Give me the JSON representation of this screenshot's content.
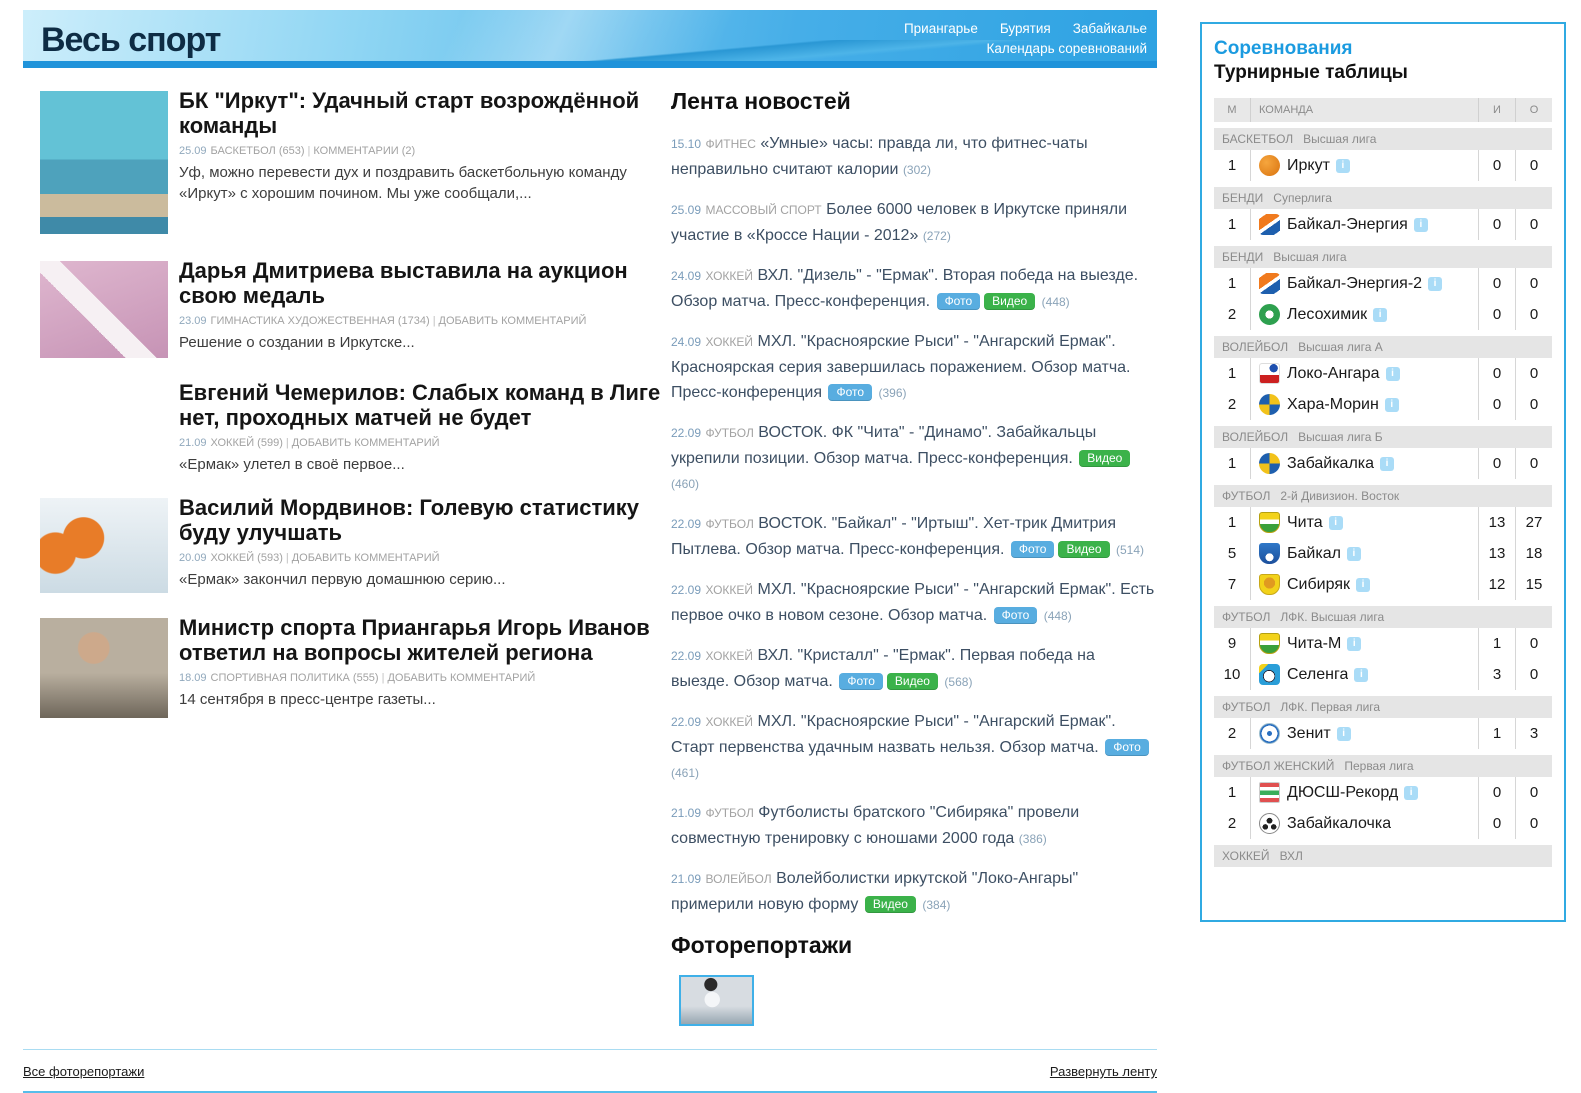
{
  "header": {
    "site_title": "Весь спорт",
    "nav": [
      {
        "label": "Приангарье"
      },
      {
        "label": "Бурятия"
      },
      {
        "label": "Забайкалье"
      }
    ],
    "calendar_label": "Календарь соревнований"
  },
  "featured": {
    "meta_separator": "|",
    "articles": [
      {
        "title": "БК \"Иркут\": Удачный старт возрождённой команды",
        "date": "25.09",
        "category": "БАСКЕТБОЛ (653)",
        "comments": "КОММЕНТАРИИ (2)",
        "excerpt": "Уф, можно перевести дух и поздравить баскетбольную команду «Иркут» с хорошим почином. Мы уже сообщали,...",
        "image": "basketball-team"
      },
      {
        "title": "Дарья Дмитриева выставила на аукцион свою медаль",
        "date": "23.09",
        "category": "ГИМНАСТИКА ХУДОЖЕСТВЕННАЯ (1734)",
        "comments": "ДОБАВИТЬ КОММЕНТАРИЙ",
        "excerpt": "Решение о создании в Иркутске...",
        "image": "medal-hand"
      },
      {
        "title": "Евгений Чемерилов: Слабых команд в Лиге нет, проходных матчей не будет",
        "date": "21.09",
        "category": "ХОККЕЙ (599)",
        "comments": "ДОБАВИТЬ КОММЕНТАРИЙ",
        "excerpt": "«Ермак» улетел в своё первое...",
        "image": ""
      },
      {
        "title": "Василий Мордвинов: Голевую статистику буду улучшать",
        "date": "20.09",
        "category": "ХОККЕЙ (593)",
        "comments": "ДОБАВИТЬ КОММЕНТАРИЙ",
        "excerpt": "«Ермак» закончил первую домашнюю серию...",
        "image": "hockey-players"
      },
      {
        "title": "Министр спорта Приангарья Игорь Иванов ответил на вопросы жителей региона",
        "date": "18.09",
        "category": "СПОРТИВНАЯ ПОЛИТИКА (555)",
        "comments": "ДОБАВИТЬ КОММЕНТАРИЙ",
        "excerpt": "14 сентября в пресс-центре газеты...",
        "image": "minister-portrait"
      }
    ]
  },
  "news": {
    "title": "Лента новостей",
    "expand_link": "Развернуть ленту",
    "items": [
      {
        "date": "15.10",
        "category": "ФИТНЕС",
        "title": "«Умные» часы: правда ли, что фитнес-чаты неправильно считают калории",
        "views": "(302)",
        "badges": []
      },
      {
        "date": "25.09",
        "category": "МАССОВЫЙ СПОРТ",
        "title": "Более 6000 человек в Иркутске приняли участие в «Кроссе Нации - 2012»",
        "views": "(272)",
        "badges": []
      },
      {
        "date": "24.09",
        "category": "ХОККЕЙ",
        "title": "ВХЛ. \"Дизель\" - \"Ермак\". Вторая победа на выезде. Обзор матча. Пресс-конференция.",
        "views": "(448)",
        "badges": [
          {
            "label": "Фото",
            "type": "photo"
          },
          {
            "label": "Видео",
            "type": "video"
          }
        ]
      },
      {
        "date": "24.09",
        "category": "ХОККЕЙ",
        "title": "МХЛ. \"Красноярские Рыси\" - \"Ангарский Ермак\". Красноярская серия завершилась поражением. Обзор матча. Пресс-конференция",
        "views": "(396)",
        "badges": [
          {
            "label": "Фото",
            "type": "photo"
          }
        ]
      },
      {
        "date": "22.09",
        "category": "ФУТБОЛ",
        "title": "ВОСТОК. ФК \"Чита\" - \"Динамо\". Забайкальцы укрепили позиции. Обзор матча. Пресс-конференция.",
        "views": "(460)",
        "badges": [
          {
            "label": "Видео",
            "type": "video"
          }
        ]
      },
      {
        "date": "22.09",
        "category": "ФУТБОЛ",
        "title": "ВОСТОК. \"Байкал\" - \"Иртыш\". Хет-трик Дмитрия Пытлева. Обзор матча. Пресс-конференция.",
        "views": "(514)",
        "badges": [
          {
            "label": "Фото",
            "type": "photo"
          },
          {
            "label": "Видео",
            "type": "video"
          }
        ]
      },
      {
        "date": "22.09",
        "category": "ХОККЕЙ",
        "title": "МХЛ. \"Красноярские Рыси\" - \"Ангарский Ермак\". Есть первое очко в новом сезоне. Обзор матча.",
        "views": "(448)",
        "badges": [
          {
            "label": "Фото",
            "type": "photo"
          }
        ]
      },
      {
        "date": "22.09",
        "category": "ХОККЕЙ",
        "title": "ВХЛ. \"Кристалл\" - \"Ермак\". Первая победа на выезде. Обзор матча.",
        "views": "(568)",
        "badges": [
          {
            "label": "Фото",
            "type": "photo"
          },
          {
            "label": "Видео",
            "type": "video"
          }
        ]
      },
      {
        "date": "22.09",
        "category": "ХОККЕЙ",
        "title": "МХЛ. \"Красноярские Рыси\" - \"Ангарский Ермак\". Старт первенства удачным назвать нельзя. Обзор матча.",
        "views": "(461)",
        "badges": [
          {
            "label": "Фото",
            "type": "photo"
          }
        ]
      },
      {
        "date": "21.09",
        "category": "ФУТБОЛ",
        "title": "Футболисты братского \"Сибиряка\" провели совместную тренировку с юношами 2000 года",
        "views": "(386)",
        "badges": []
      },
      {
        "date": "21.09",
        "category": "ВОЛЕЙБОЛ",
        "title": "Волейболистки иркутской \"Локо-Ангары\" примерили новую форму",
        "views": "(384)",
        "badges": [
          {
            "label": "Видео",
            "type": "video"
          }
        ]
      }
    ]
  },
  "photo_reports": {
    "title": "Фоторепортажи",
    "all_link": "Все фоторепортажи",
    "thumbnails": [
      {
        "image": "football-throw-in"
      }
    ]
  },
  "standings": {
    "title": "Соревнования",
    "subtitle": "Турнирные таблицы",
    "info_glyph": "i",
    "columns": {
      "rank": "М",
      "team": "КОМАНДА",
      "games": "И",
      "points": "О"
    },
    "groups": [
      {
        "sport": "БАСКЕТБОЛ",
        "league": "Высшая лига",
        "rows": [
          {
            "rank": "1",
            "team": "Иркут",
            "games": "0",
            "points": "0",
            "info": true,
            "logo": "irkut"
          }
        ]
      },
      {
        "sport": "БЕНДИ",
        "league": "Суперлига",
        "rows": [
          {
            "rank": "1",
            "team": "Байкал-Энергия",
            "games": "0",
            "points": "0",
            "info": true,
            "logo": "benergia"
          }
        ]
      },
      {
        "sport": "БЕНДИ",
        "league": "Высшая лига",
        "rows": [
          {
            "rank": "1",
            "team": "Байкал-Энергия-2",
            "games": "0",
            "points": "0",
            "info": true,
            "logo": "benergia"
          },
          {
            "rank": "2",
            "team": "Лесохимик",
            "games": "0",
            "points": "0",
            "info": true,
            "logo": "lesohimik"
          }
        ]
      },
      {
        "sport": "ВОЛЕЙБОЛ",
        "league": "Высшая лига А",
        "rows": [
          {
            "rank": "1",
            "team": "Локо-Ангара",
            "games": "0",
            "points": "0",
            "info": true,
            "logo": "loko"
          },
          {
            "rank": "2",
            "team": "Хара-Морин",
            "games": "0",
            "points": "0",
            "info": true,
            "logo": "volley"
          }
        ]
      },
      {
        "sport": "ВОЛЕЙБОЛ",
        "league": "Высшая лига Б",
        "rows": [
          {
            "rank": "1",
            "team": "Забайкалка",
            "games": "0",
            "points": "0",
            "info": true,
            "logo": "volley"
          }
        ]
      },
      {
        "sport": "ФУТБОЛ",
        "league": "2-й Дивизион. Восток",
        "rows": [
          {
            "rank": "1",
            "team": "Чита",
            "games": "13",
            "points": "27",
            "info": true,
            "logo": "chita"
          },
          {
            "rank": "5",
            "team": "Байкал",
            "games": "13",
            "points": "18",
            "info": true,
            "logo": "baikalfc"
          },
          {
            "rank": "7",
            "team": "Сибиряк",
            "games": "12",
            "points": "15",
            "info": true,
            "logo": "sibiryak"
          }
        ]
      },
      {
        "sport": "ФУТБОЛ",
        "league": "ЛФК. Высшая лига",
        "rows": [
          {
            "rank": "9",
            "team": "Чита-М",
            "games": "1",
            "points": "0",
            "info": true,
            "logo": "chita"
          },
          {
            "rank": "10",
            "team": "Селенга",
            "games": "3",
            "points": "0",
            "info": true,
            "logo": "selenga"
          }
        ]
      },
      {
        "sport": "ФУТБОЛ",
        "league": "ЛФК. Первая лига",
        "rows": [
          {
            "rank": "2",
            "team": "Зенит",
            "games": "1",
            "points": "3",
            "info": true,
            "logo": "zenit"
          }
        ]
      },
      {
        "sport": "ФУТБОЛ ЖЕНСКИЙ",
        "league": "Первая лига",
        "rows": [
          {
            "rank": "1",
            "team": "ДЮСШ-Рекорд",
            "games": "0",
            "points": "0",
            "info": true,
            "logo": "rekord"
          },
          {
            "rank": "2",
            "team": "Забайкалочка",
            "games": "0",
            "points": "0",
            "info": false,
            "logo": "ball"
          }
        ]
      },
      {
        "sport": "ХОККЕЙ",
        "league": "ВХЛ",
        "rows": []
      }
    ]
  },
  "colors": {
    "banner_blue": "#2da2e2",
    "banner_bottom_strip": "#1f93da",
    "sidebar_border": "#30aae2",
    "accent_blue": "#1b9be0",
    "badge_photo": "#58ade0",
    "badge_video": "#3bb24a",
    "divider_light_blue": "#a9dcf2",
    "bottom_line_blue": "#57bdea"
  }
}
